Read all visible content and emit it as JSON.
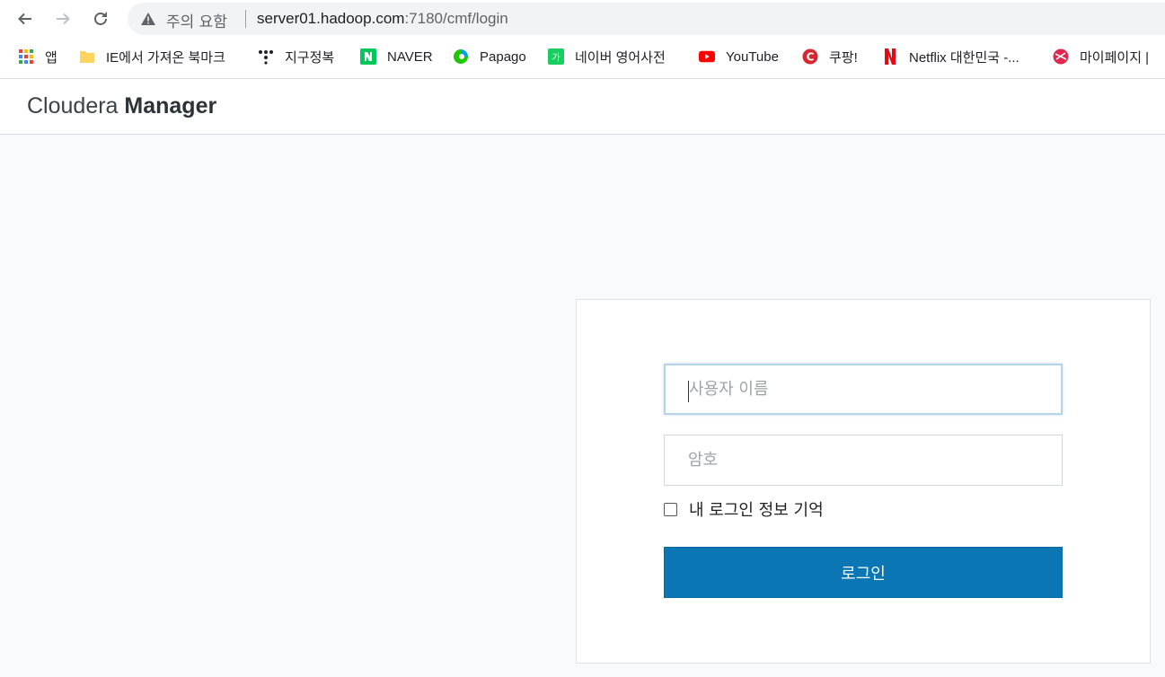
{
  "browser": {
    "security_label": "주의 요함",
    "url_host": "server01.hadoop.com",
    "url_path": ":7180/cmf/login",
    "bookmarks": [
      {
        "label": "앱",
        "icon": "apps-grid-icon"
      },
      {
        "label": "IE에서 가져온 북마크",
        "icon": "folder-icon"
      },
      {
        "label": "지구정복",
        "icon": "dots-icon"
      },
      {
        "label": "NAVER",
        "icon": "naver-icon"
      },
      {
        "label": "Papago",
        "icon": "papago-icon"
      },
      {
        "label": "네이버 영어사전",
        "icon": "naver-dictionary-icon"
      },
      {
        "label": "YouTube",
        "icon": "youtube-icon"
      },
      {
        "label": "쿠팡!",
        "icon": "coupang-icon"
      },
      {
        "label": "Netflix 대한민국 -...",
        "icon": "netflix-icon"
      },
      {
        "label": "마이페이지 | ",
        "icon": "mypage-icon"
      }
    ]
  },
  "app": {
    "brand_light": "Cloudera ",
    "brand_bold": "Manager"
  },
  "login": {
    "username_placeholder": "사용자 이름",
    "password_placeholder": "암호",
    "remember_label": "내 로그인 정보 기억",
    "remember_checked": false,
    "submit_label": "로그인"
  },
  "colors": {
    "primary_button": "#0a76b3",
    "page_background": "#f9fafc",
    "focus_border": "#b7d3e6"
  }
}
